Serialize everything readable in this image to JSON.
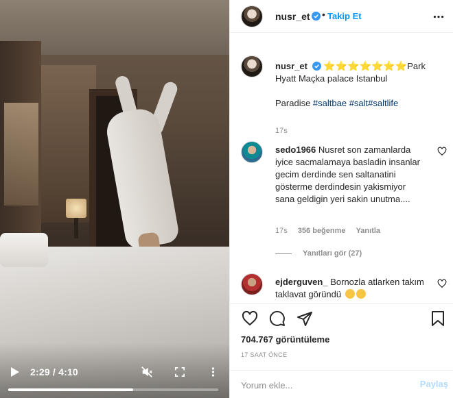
{
  "video": {
    "time": "2:29 / 4:10",
    "progress": 0.596,
    "play_icon": "play-icon",
    "mute_icon": "muted-speaker-icon",
    "fullscreen_icon": "fullscreen-icon",
    "more_icon": "vertical-ellipsis-icon"
  },
  "header": {
    "username": "nusr_et",
    "dot": "•",
    "follow_label": "Takip Et"
  },
  "caption": {
    "username": "nusr_et",
    "stars": "⭐⭐⭐⭐⭐⭐⭐",
    "text_1": "Park Hyatt Maçka palace Istanbul",
    "text_2": "Paradise ",
    "hashtags": [
      "#saltbae",
      "#salt",
      "#saltlife"
    ],
    "time": "17s"
  },
  "comments": [
    {
      "username": "sedo1966",
      "text": "Nusret son zamanlarda iyice sacmalamaya basladin insanlar gecim derdinde sen saltanatini gösterme derdindesin yakismiyor sana geldigin yeri sakin unutma....",
      "time": "17s",
      "likes": "356 beğenme",
      "reply_label": "Yanıtla",
      "view_replies": "Yanıtları gör (27)"
    },
    {
      "username": "ejderguven_",
      "text": "Bornozla atlarken takım taklavat göründü"
    }
  ],
  "actions": {
    "views": "704.767 görüntüleme",
    "time_ago": "17 SAAT ÖNCE"
  },
  "add_comment": {
    "placeholder": "Yorum ekle...",
    "post_label": "Paylaş"
  },
  "colors": {
    "accent": "#0095f6",
    "link": "#00376b",
    "muted": "#8e8e8e",
    "post_disabled": "#b3dbff",
    "stars": "#f0b400"
  }
}
